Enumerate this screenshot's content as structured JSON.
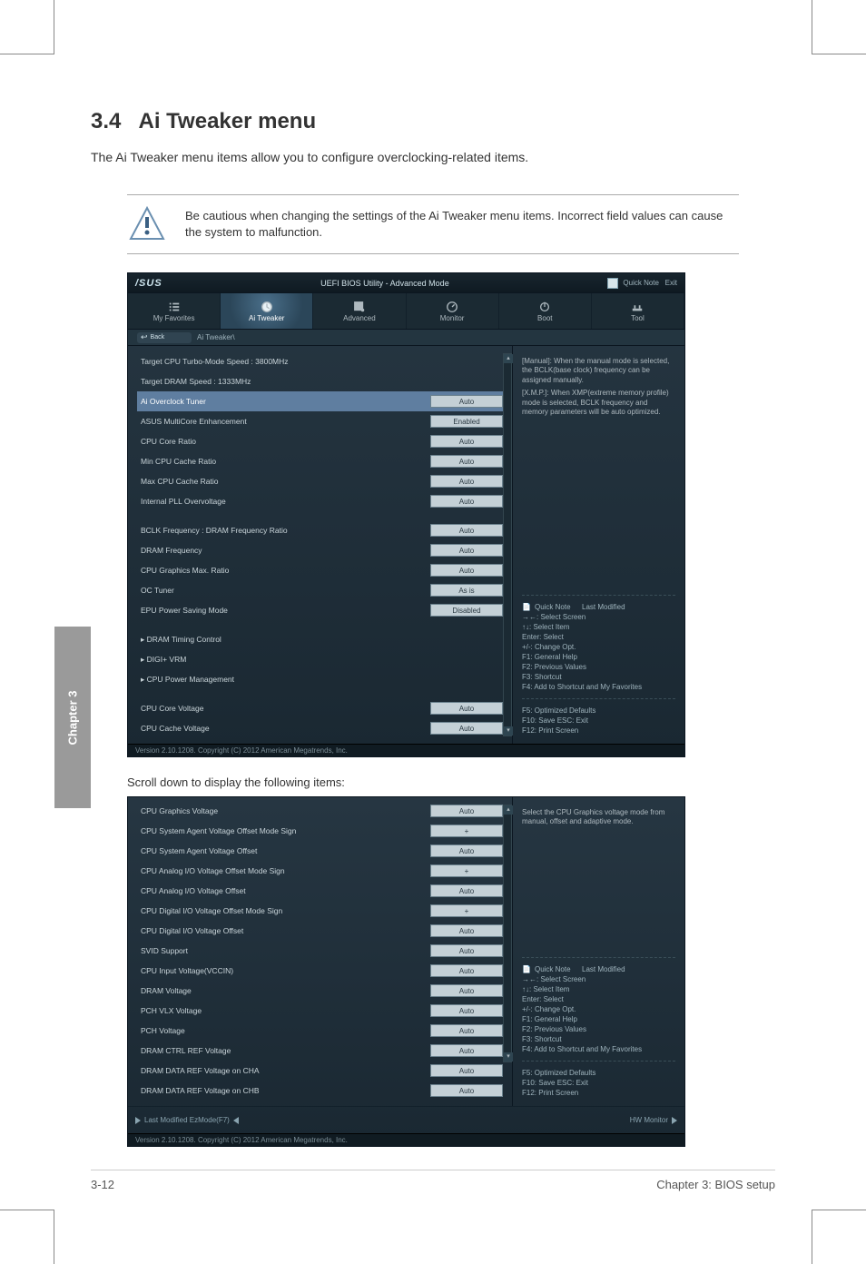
{
  "page": {
    "section_number": "3.4",
    "section_title": "Ai Tweaker menu",
    "intro": "The Ai Tweaker menu items allow you to configure overclocking-related items.",
    "warning": "Be cautious when changing the settings of the Ai Tweaker menu items. Incorrect field values can cause the system to malfunction.",
    "scroll_note": "Scroll down to display the following items:",
    "footer_left": "3-12",
    "footer_right": "Chapter 3: BIOS setup",
    "chapter_tab": "Chapter 3"
  },
  "bios": {
    "brand": "/SUS",
    "header_title": "UEFI BIOS Utility - Advanced Mode",
    "exit_label": "Exit",
    "qnote_label": "Quick Note",
    "tabs": [
      {
        "label": "My Favorites",
        "icon": "list"
      },
      {
        "label": "Ai Tweaker",
        "icon": "clock"
      },
      {
        "label": "Advanced",
        "icon": "advanced"
      },
      {
        "label": "Monitor",
        "icon": "monitor"
      },
      {
        "label": "Boot",
        "icon": "power"
      },
      {
        "label": "Tool",
        "icon": "tool"
      }
    ],
    "back_label": "Back",
    "breadcrumb": "Ai Tweaker\\",
    "settings1": [
      {
        "label": "Target CPU Turbo-Mode Speed : 3800MHz",
        "value": null,
        "type": "text"
      },
      {
        "label": "Target DRAM Speed : 1333MHz",
        "value": null,
        "type": "text"
      },
      {
        "label": "Ai Overclock Tuner",
        "value": "Auto",
        "type": "box",
        "selected": true
      },
      {
        "label": "ASUS MultiCore Enhancement",
        "value": "Enabled",
        "type": "box"
      },
      {
        "label": "CPU Core Ratio",
        "value": "Auto",
        "type": "box"
      },
      {
        "label": "Min CPU Cache Ratio",
        "value": "Auto",
        "type": "box"
      },
      {
        "label": "Max CPU Cache Ratio",
        "value": "Auto",
        "type": "box"
      },
      {
        "label": "Internal PLL Overvoltage",
        "value": "Auto",
        "type": "box"
      },
      {
        "gap": true
      },
      {
        "label": "BCLK Frequency : DRAM Frequency Ratio",
        "value": "Auto",
        "type": "box"
      },
      {
        "label": "DRAM Frequency",
        "value": "Auto",
        "type": "box"
      },
      {
        "label": "CPU Graphics Max. Ratio",
        "value": "Auto",
        "type": "box"
      },
      {
        "label": "OC Tuner",
        "value": "As is",
        "type": "box"
      },
      {
        "label": "EPU Power Saving Mode",
        "value": "Disabled",
        "type": "box"
      },
      {
        "gap": true
      },
      {
        "label": "DRAM Timing Control",
        "value": null,
        "type": "link"
      },
      {
        "label": "DIGI+ VRM",
        "value": null,
        "type": "link"
      },
      {
        "label": "CPU Power Management",
        "value": null,
        "type": "link"
      },
      {
        "gap": true
      },
      {
        "label": "CPU Core Voltage",
        "value": "Auto",
        "type": "box"
      },
      {
        "label": "CPU Cache Voltage",
        "value": "Auto",
        "type": "box"
      }
    ],
    "settings2": [
      {
        "label": "CPU Graphics Voltage",
        "value": "Auto",
        "type": "box"
      },
      {
        "label": "CPU System Agent Voltage Offset Mode Sign",
        "value": "+",
        "type": "box"
      },
      {
        "label": " CPU System Agent Voltage Offset",
        "value": "Auto",
        "type": "box"
      },
      {
        "label": "CPU Analog I/O Voltage Offset Mode Sign",
        "value": "+",
        "type": "box"
      },
      {
        "label": " CPU Analog I/O Voltage Offset",
        "value": "Auto",
        "type": "box"
      },
      {
        "label": "CPU Digital I/O Voltage Offset Mode Sign",
        "value": "+",
        "type": "box"
      },
      {
        "label": " CPU Digital I/O Voltage Offset",
        "value": "Auto",
        "type": "box"
      },
      {
        "label": "SVID Support",
        "value": "Auto",
        "type": "box"
      },
      {
        "label": "CPU Input Voltage(VCCIN)",
        "value": "Auto",
        "type": "box"
      },
      {
        "label": "DRAM Voltage",
        "value": "Auto",
        "type": "box"
      },
      {
        "label": "PCH VLX Voltage",
        "value": "Auto",
        "type": "box"
      },
      {
        "label": "PCH Voltage",
        "value": "Auto",
        "type": "box"
      },
      {
        "label": "DRAM CTRL REF Voltage",
        "value": "Auto",
        "type": "box"
      },
      {
        "label": "DRAM DATA REF Voltage on CHA",
        "value": "Auto",
        "type": "box"
      },
      {
        "label": "DRAM DATA REF Voltage on CHB",
        "value": "Auto",
        "type": "box"
      }
    ],
    "side": {
      "desc_title": "[Manual]: When the manual mode is selected, the BCLK(base clock) frequency can be assigned manually.",
      "desc_line2": "[X.M.P.]: When XMP(extreme memory profile) mode is selected, BCLK frequency and memory parameters will be auto optimized.",
      "nav_title": "Quick Note",
      "last_mod": "Last Modified",
      "nav_arrows": "→←: Select Screen",
      "nav_updown": "↑↓: Select Item",
      "nav_enter": "Enter: Select",
      "nav_plusminus": "+/-: Change Opt.",
      "nav_f1": "F1: General Help",
      "nav_f2": "F2: Previous Values",
      "nav_f3": "F3: Shortcut",
      "nav_f4": "F4: Add to Shortcut and My Favorites",
      "nav_f5": "F5: Optimized Defaults",
      "nav_f10": "F10: Save ESC: Exit",
      "nav_f12": "F12: Print Screen"
    },
    "footer": {
      "version": "Version 2.10.1208. Copyright (C) 2012 American Megatrends, Inc.",
      "hwmon_left": "Last Modified  EzMode(F7)",
      "hwmon_label": "HW Monitor"
    }
  }
}
